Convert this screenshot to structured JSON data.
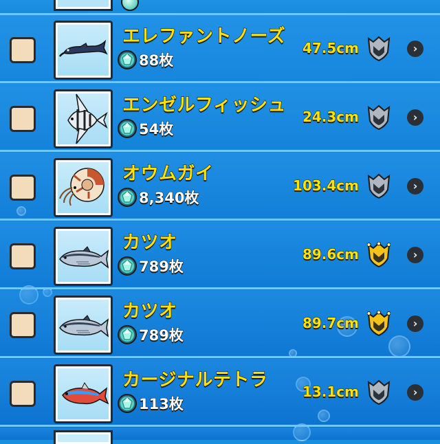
{
  "list": {
    "items": [
      {
        "name": "エレファントノーズ",
        "count": "88枚",
        "size": "47.5cm",
        "rank": "silver",
        "fish": "elephantnose",
        "checked": false
      },
      {
        "name": "エンゼルフィッシュ",
        "count": "54枚",
        "size": "24.3cm",
        "rank": "silver",
        "fish": "angelfish",
        "checked": false
      },
      {
        "name": "オウムガイ",
        "count": "8,340枚",
        "size": "103.4cm",
        "rank": "silver",
        "fish": "nautilus",
        "checked": false
      },
      {
        "name": "カツオ",
        "count": "789枚",
        "size": "89.6cm",
        "rank": "gold",
        "fish": "skipjack",
        "checked": false
      },
      {
        "name": "カツオ",
        "count": "789枚",
        "size": "89.7cm",
        "rank": "gold",
        "fish": "skipjack",
        "checked": false
      },
      {
        "name": "カージナルテトラ",
        "count": "113枚",
        "size": "13.1cm",
        "rank": "silver",
        "fish": "cardinal-tetra",
        "checked": false
      }
    ]
  },
  "colors": {
    "name_text": "#ffe300",
    "count_text": "#ffffff",
    "row_separator": "#6ec8ff",
    "background": "#1180d6",
    "checkbox": "#f2dcbc"
  },
  "icons": {
    "currency": "gem-icon",
    "rank_silver": "silver-shield-icon",
    "rank_gold": "gold-crown-shield-icon",
    "detail": "chevron-right-icon"
  },
  "chevron_glyph": "›"
}
